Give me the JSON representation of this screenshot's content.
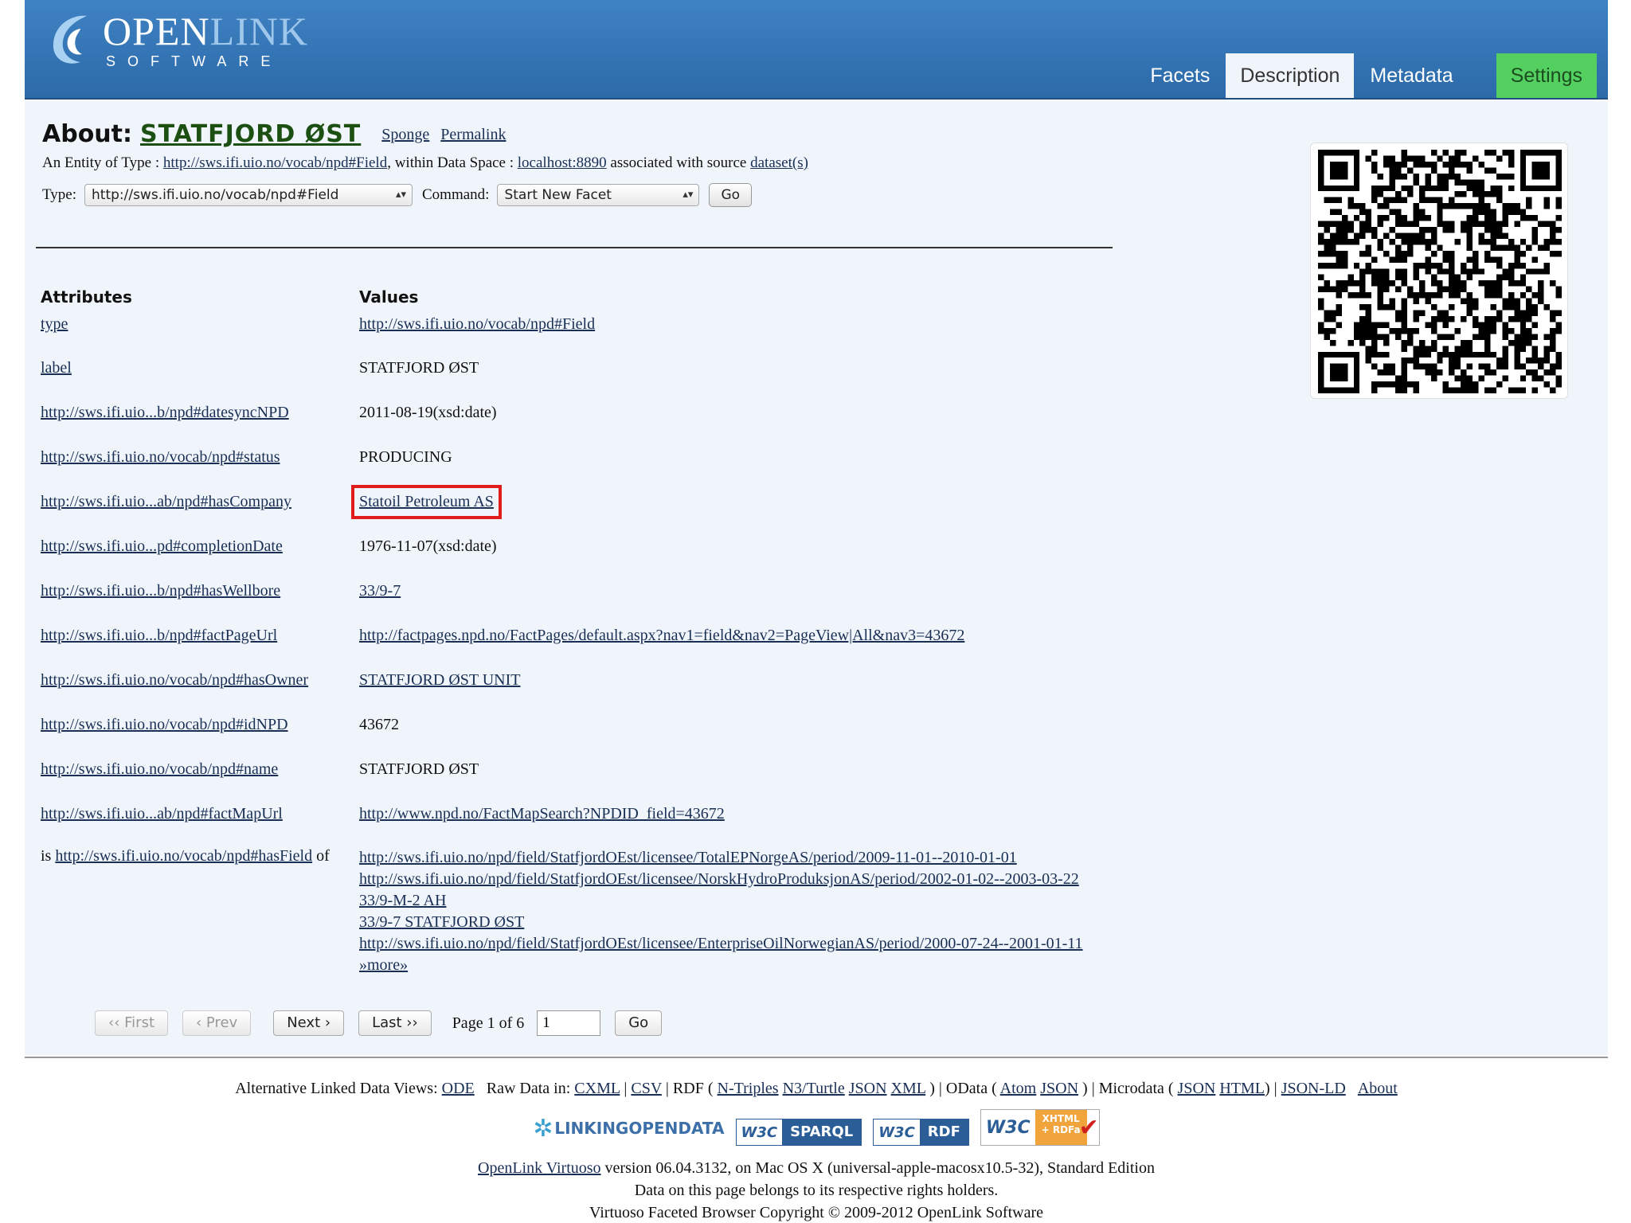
{
  "logo": {
    "word_a": "OPEN",
    "word_b": "LINK",
    "word_c": "SOFTWARE"
  },
  "tabs": [
    {
      "label": "Facets"
    },
    {
      "label": "Description"
    },
    {
      "label": "Metadata"
    },
    {
      "label": "Settings"
    }
  ],
  "about": {
    "label": "About:",
    "entity": "STATFJORD ØST",
    "sponge": "Sponge",
    "permalink": "Permalink"
  },
  "entity_line": {
    "prefix": "An Entity of Type :",
    "type_link": "http://sws.ifi.uio.no/vocab/npd#Field",
    "mid": ", within Data Space :",
    "space_link": "localhost:8890",
    "suffix": " associated with source ",
    "dataset_link": "dataset(s)"
  },
  "controls": {
    "type_label": "Type:",
    "type_value": "http://sws.ifi.uio.no/vocab/npd#Field",
    "command_label": "Command:",
    "command_value": "Start New Facet",
    "go": "Go"
  },
  "table": {
    "attr_header": "Attributes",
    "val_header": "Values",
    "rows": [
      {
        "attr": "type",
        "value": "http://sws.ifi.uio.no/vocab/npd#Field",
        "link": true
      },
      {
        "attr": "label",
        "value": "STATFJORD ØST",
        "link": false
      },
      {
        "attr": "http://sws.ifi.uio...b/npd#datesyncNPD",
        "value": "2011-08-19(xsd:date)",
        "link": false
      },
      {
        "attr": "http://sws.ifi.uio.no/vocab/npd#status",
        "value": "PRODUCING",
        "link": false
      },
      {
        "attr": "http://sws.ifi.uio...ab/npd#hasCompany",
        "value": "Statoil Petroleum AS",
        "link": true
      },
      {
        "attr": "http://sws.ifi.uio...pd#completionDate",
        "value": "1976-11-07(xsd:date)",
        "link": false
      },
      {
        "attr": "http://sws.ifi.uio...b/npd#hasWellbore",
        "value": "33/9-7",
        "link": true
      },
      {
        "attr": "http://sws.ifi.uio...b/npd#factPageUrl",
        "value": "http://factpages.npd.no/FactPages/default.aspx?nav1=field&nav2=PageView|All&nav3=43672",
        "link": true
      },
      {
        "attr": "http://sws.ifi.uio.no/vocab/npd#hasOwner",
        "value": "STATFJORD ØST UNIT",
        "link": true
      },
      {
        "attr": "http://sws.ifi.uio.no/vocab/npd#idNPD",
        "value": "43672",
        "link": false
      },
      {
        "attr": "http://sws.ifi.uio.no/vocab/npd#name",
        "value": "STATFJORD ØST",
        "link": false
      },
      {
        "attr": "http://sws.ifi.uio...ab/npd#factMapUrl",
        "value": "http://www.npd.no/FactMapSearch?NPDID_field=43672",
        "link": true
      }
    ],
    "inverse": {
      "is": "is",
      "attr": "http://sws.ifi.uio.no/vocab/npd#hasField",
      "of": "of",
      "values": [
        "http://sws.ifi.uio.no/npd/field/StatfjordOEst/licensee/TotalEPNorgeAS/period/2009-11-01--2010-01-01",
        "http://sws.ifi.uio.no/npd/field/StatfjordOEst/licensee/NorskHydroProduksjonAS/period/2002-01-02--2003-03-22",
        "33/9-M-2 AH",
        "33/9-7 STATFJORD ØST",
        "http://sws.ifi.uio.no/npd/field/StatfjordOEst/licensee/EnterpriseOilNorwegianAS/period/2000-07-24--2001-01-11",
        "»more»"
      ]
    }
  },
  "pager": {
    "first": "‹‹ First",
    "prev": "‹ Prev",
    "next": "Next ›",
    "last": "Last ››",
    "page_text": "Page 1 of 6",
    "page_input": "1",
    "go": "Go"
  },
  "footer": {
    "alt_label": "Alternative Linked Data Views:",
    "ode": "ODE",
    "raw_label": "Raw Data in:",
    "cxml": "CXML",
    "csv": "CSV",
    "rdf_label": "RDF (",
    "ntriples": "N-Triples",
    "n3turtle": "N3/Turtle",
    "json": "JSON",
    "xml": "XML",
    "odata_label": ") | OData (",
    "atom": "Atom",
    "odata_json": "JSON",
    "microdata_label": ") | Microdata (",
    "md_json": "JSON",
    "md_html": "HTML",
    "jsonld": "JSON-LD",
    "about": "About",
    "badge_lod": "LINKINGOPENDATA",
    "badge_w3c": "W3C",
    "badge_sparql": "SPARQL",
    "badge_rdf": "RDF",
    "badge_rdfa_a": "XHTML",
    "badge_rdfa_b": "+ RDFa",
    "virtuoso_link": "OpenLink Virtuoso",
    "version": " version 06.04.3132, on Mac OS X (universal-apple-macosx10.5-32), Standard Edition",
    "rights": "Data on this page belongs to its respective rights holders.",
    "copyright": "Virtuoso Faceted Browser Copyright © 2009-2012 OpenLink Software"
  },
  "colors": {
    "header": "#3f82c3",
    "settings_tab": "#54d061",
    "highlight_box": "#e11c1c",
    "panel_bg": "#f0f5fb"
  }
}
